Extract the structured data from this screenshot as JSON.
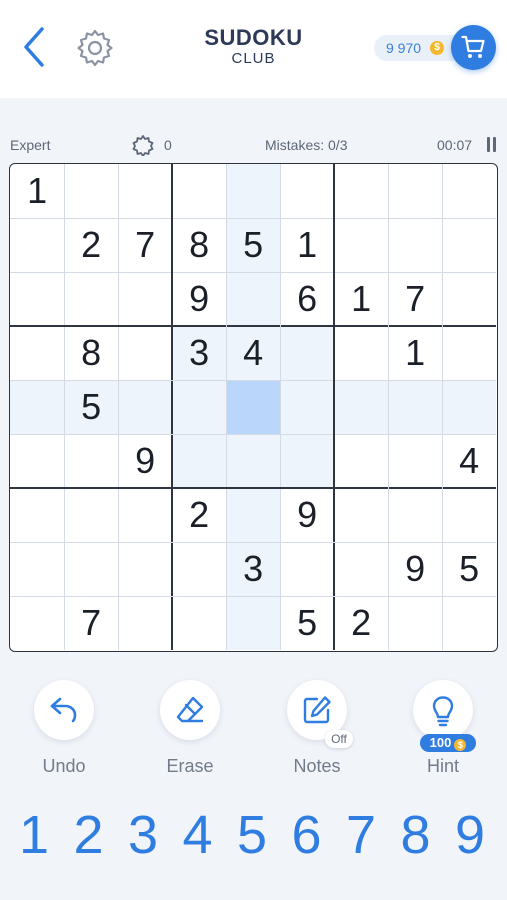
{
  "header": {
    "title": "SUDOKU",
    "subtitle": "CLUB",
    "coins": "9 970",
    "coin_symbol": "$"
  },
  "status": {
    "difficulty": "Expert",
    "score": "0",
    "mistakes": "Mistakes: 0/3",
    "timer": "00:07"
  },
  "board": {
    "selected": [
      4,
      4
    ],
    "rows": [
      [
        "1",
        "",
        "",
        "",
        "",
        "",
        "",
        "",
        ""
      ],
      [
        "",
        "2",
        "7",
        "8",
        "5",
        "1",
        "",
        "",
        ""
      ],
      [
        "",
        "",
        "",
        "9",
        "",
        "6",
        "1",
        "7",
        ""
      ],
      [
        "",
        "8",
        "",
        "3",
        "4",
        "",
        "",
        "1",
        ""
      ],
      [
        "",
        "5",
        "",
        "",
        "",
        "",
        "",
        "",
        ""
      ],
      [
        "",
        "",
        "9",
        "",
        "",
        "",
        "",
        "",
        "4"
      ],
      [
        "",
        "",
        "",
        "2",
        "",
        "9",
        "",
        "",
        ""
      ],
      [
        "",
        "",
        "",
        "",
        "3",
        "",
        "",
        "9",
        "5"
      ],
      [
        "",
        "7",
        "",
        "",
        "",
        "5",
        "2",
        "",
        ""
      ]
    ]
  },
  "tools": {
    "undo": "Undo",
    "erase": "Erase",
    "notes": "Notes",
    "notes_state": "Off",
    "hint": "Hint",
    "hint_cost": "100",
    "hint_coin": "$"
  },
  "numpad": [
    "1",
    "2",
    "3",
    "4",
    "5",
    "6",
    "7",
    "8",
    "9"
  ],
  "colors": {
    "accent": "#2f7de1",
    "selected_cell": "#bad6fb",
    "peer_cell": "#eef4fc",
    "coin": "#f5b82e"
  }
}
